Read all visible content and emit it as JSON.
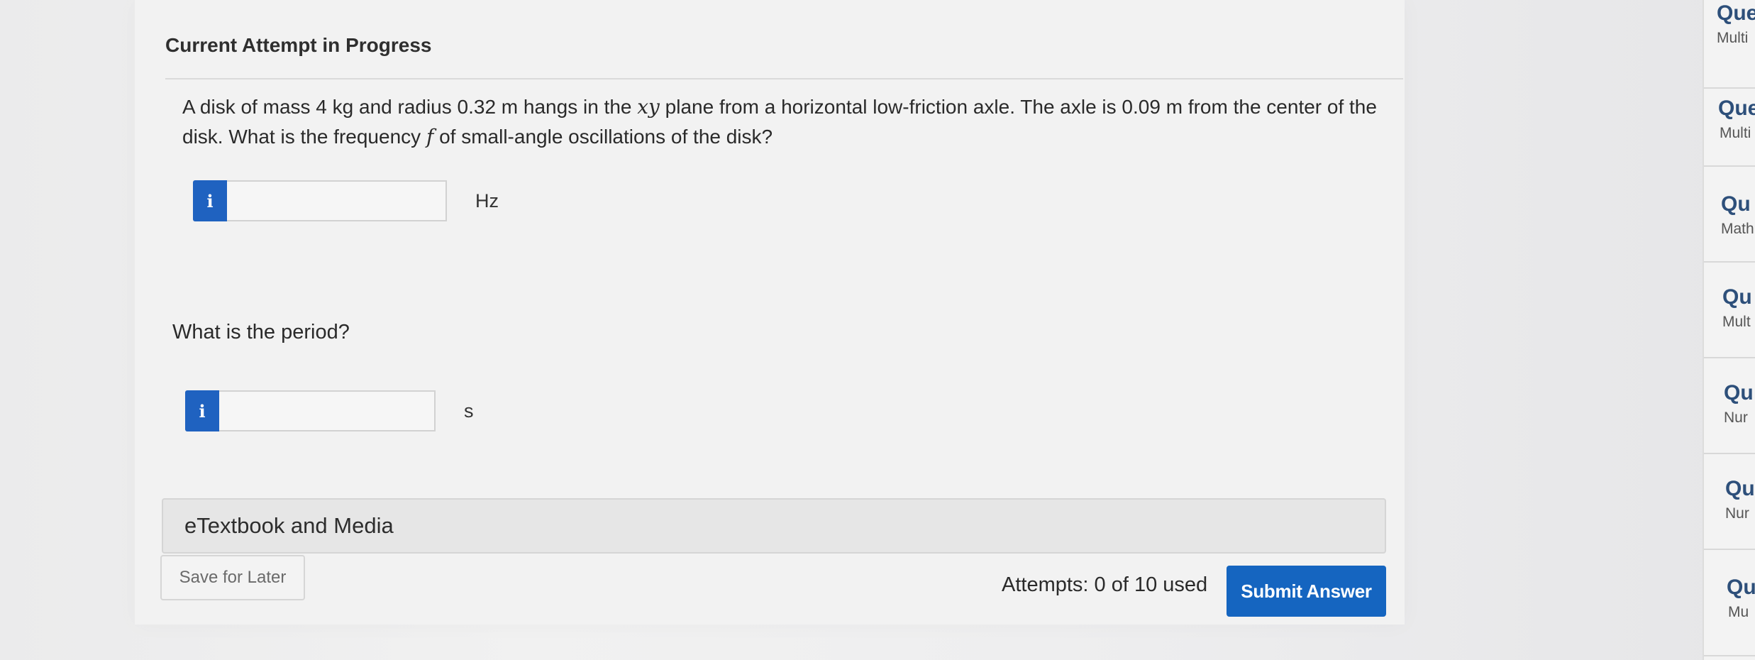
{
  "header": {
    "attempt_title": "Current Attempt in Progress"
  },
  "question": {
    "text_part1": "A disk of mass 4 kg and radius 0.32 m hangs in the ",
    "var_xy": "xy",
    "text_part2": " plane from a horizontal low-friction axle. The axle is 0.09 m from the center of the disk. What is the frequency ",
    "var_f": "f",
    "text_part3": " of small-angle oscillations of the disk?"
  },
  "answers": [
    {
      "badge": "i",
      "value": "",
      "unit": "Hz"
    },
    {
      "badge": "i",
      "value": "",
      "unit": "s"
    }
  ],
  "period_question": "What is the period?",
  "etextbook_label": "eTextbook and Media",
  "footer": {
    "save_label": "Save for Later",
    "attempts_text": "Attempts: 0 of 10 used",
    "submit_label": "Submit Answer"
  },
  "sidebar": {
    "items": [
      {
        "title": "Que",
        "subtitle": "Multi"
      },
      {
        "title": "Que",
        "subtitle": "Multi"
      },
      {
        "title": "Qu",
        "subtitle": "Math"
      },
      {
        "title": "Qu",
        "subtitle": "Mult"
      },
      {
        "title": "Qu",
        "subtitle": "Nur"
      },
      {
        "title": "Qu",
        "subtitle": "Nur"
      },
      {
        "title": "Qu",
        "subtitle": "Mu"
      }
    ]
  },
  "colors": {
    "accent": "#1565c0",
    "badge": "#1f62c0",
    "sidebar_title": "#2d4f7a"
  }
}
